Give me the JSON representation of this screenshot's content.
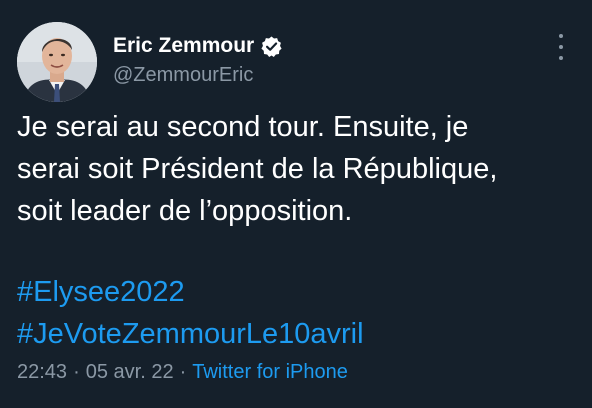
{
  "author": {
    "display_name": "Eric Zemmour",
    "handle": "@ZemmourEric",
    "verified": true
  },
  "tweet": {
    "text_lines": [
      "Je serai au second tour. Ensuite, je",
      "serai soit Président de la République,",
      "soit leader de l’opposition."
    ],
    "hashtags": [
      "#Elysee2022",
      "#JeVoteZemmourLe10avril"
    ]
  },
  "meta": {
    "time": "22:43",
    "separator": "·",
    "date": "05 avr. 22",
    "source": "Twitter for iPhone"
  },
  "icons": {
    "verified": "verified-badge-icon",
    "more": "more-vertical-icon"
  },
  "colors": {
    "background": "#15202b",
    "link": "#1d9bf0",
    "secondary_text": "#8b98a5"
  }
}
